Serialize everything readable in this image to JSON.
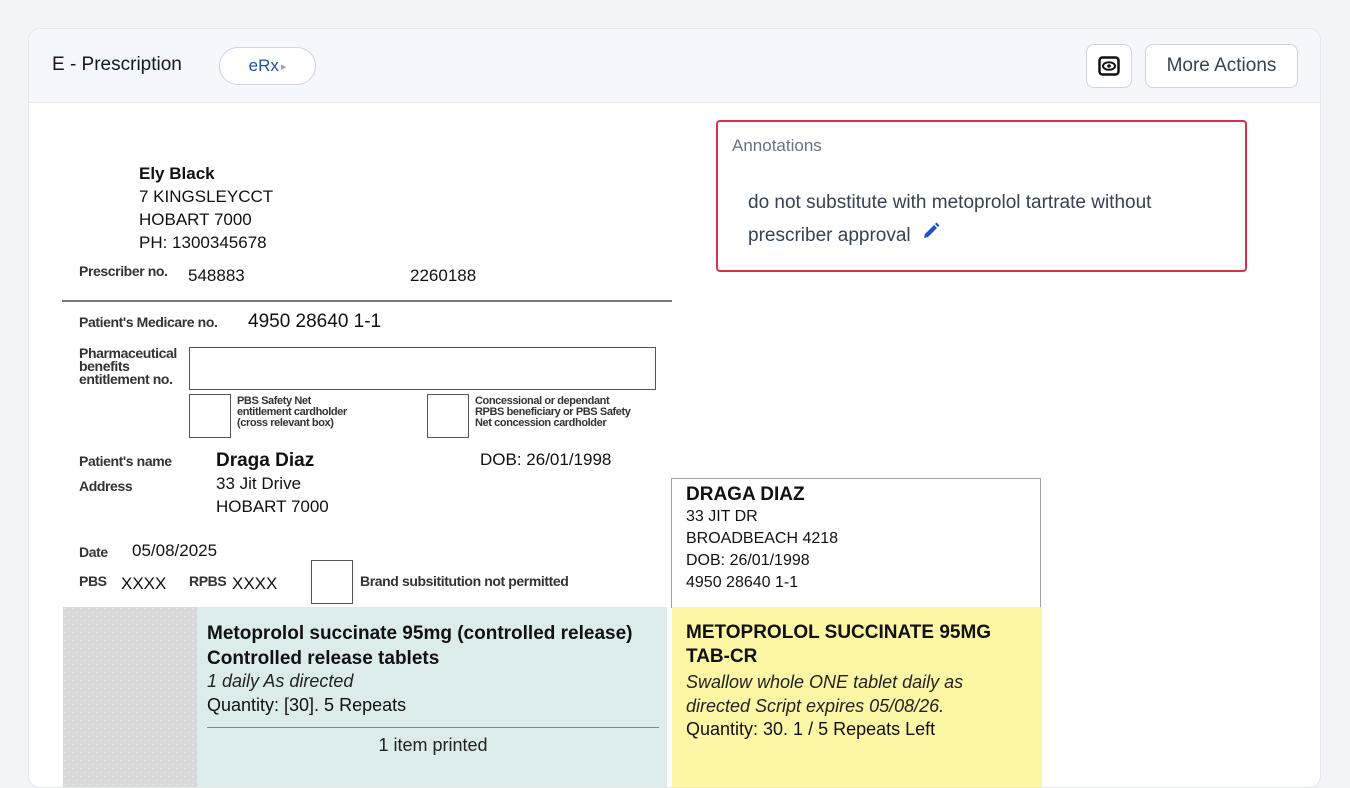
{
  "header": {
    "title": "E - Prescription",
    "badge": "eRx",
    "eye_icon": "eye-icon",
    "more_actions": "More Actions"
  },
  "annotations": {
    "label": "Annotations",
    "text": "do not substitute with metoprolol tartrate without prescriber approval",
    "edit_icon": "pencil-icon"
  },
  "prescriber": {
    "name": "Ely Black",
    "address1": "7 KINGSLEYCCT",
    "address2": "HOBART 7000",
    "phone": "PH: 1300345678",
    "no_label": "Prescriber no.",
    "no": "548883",
    "other_no": "2260188"
  },
  "patient": {
    "medicare_label": "Patient's Medicare no.",
    "medicare": "4950 28640 1-1",
    "pbs_label_1": "Pharmaceutical",
    "pbs_label_2": "benefits",
    "pbs_label_3": "entitlement no.",
    "safety_net_1": "PBS Safety Net",
    "safety_net_2": "entitlement cardholder",
    "safety_net_3": "(cross relevant box)",
    "concession_1": "Concessional or dependant",
    "concession_2": "RPBS beneficiary or PBS Safety",
    "concession_3": "Net concession cardholder",
    "name_label": "Patient's name",
    "name": "Draga Diaz",
    "dob": "DOB: 26/01/1998",
    "address_label": "Address",
    "address1": "33 Jit Drive",
    "address2": "HOBART 7000"
  },
  "script": {
    "date_label": "Date",
    "date": "05/08/2025",
    "pbs_label": "PBS",
    "pbs": "XXXX",
    "rpbs_label": "RPBS",
    "rpbs": "XXXX",
    "brand_label": "Brand subsititution not permitted"
  },
  "item": {
    "name": "Metoprolol succinate 95mg (controlled release) Controlled release tablets",
    "directions": "1 daily As directed",
    "quantity": "Quantity: [30]. 5 Repeats",
    "printed": "1 item printed"
  },
  "dispense_label": {
    "name": "DRAGA DIAZ",
    "address1": "33 JIT DR",
    "address2": "BROADBEACH 4218",
    "dob": "DOB: 26/01/1998",
    "medicare": "4950 28640 1-1",
    "drug": "METOPROLOL SUCCINATE 95MG TAB-CR",
    "directions": "Swallow whole ONE tablet daily as directed Script expires 05/08/26.",
    "quantity": "Quantity: 30. 1 / 5 Repeats Left"
  }
}
